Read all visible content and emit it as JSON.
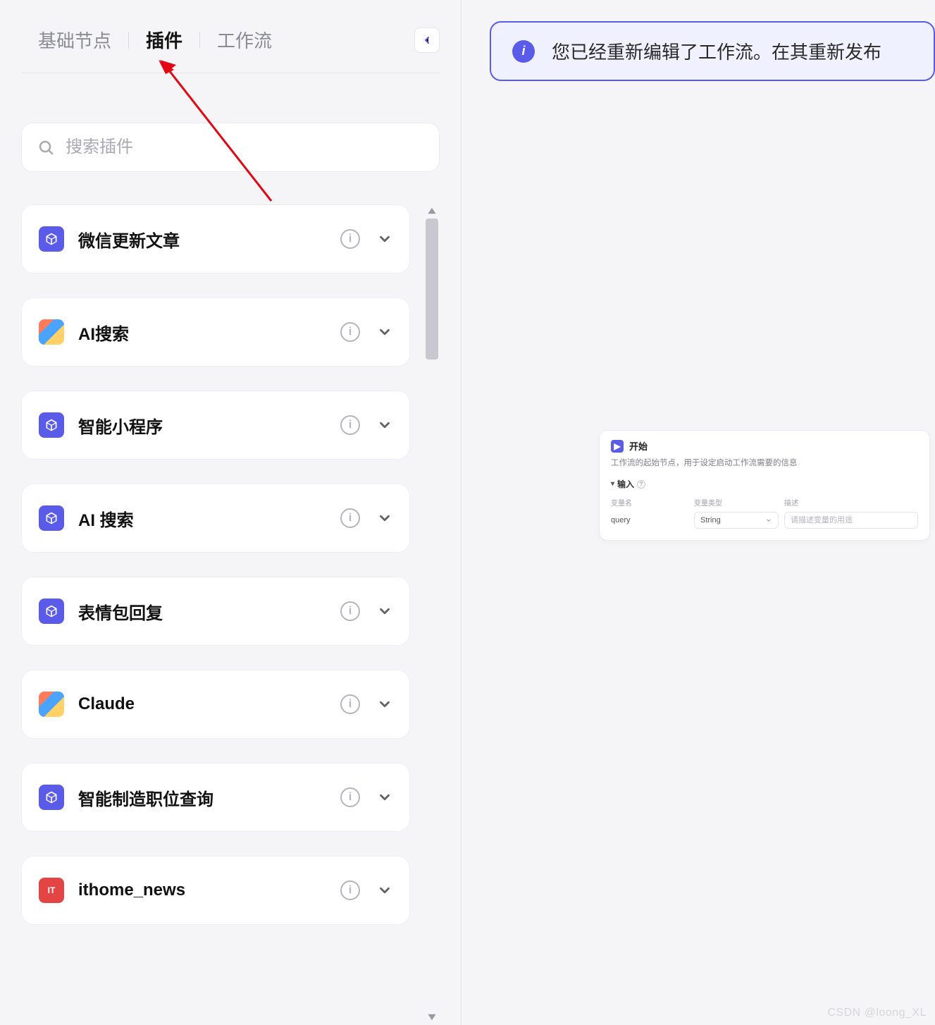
{
  "sidebar": {
    "tabs": [
      {
        "label": "基础节点",
        "active": false
      },
      {
        "label": "插件",
        "active": true
      },
      {
        "label": "工作流",
        "active": false
      }
    ],
    "search_placeholder": "搜索插件",
    "plugins": [
      {
        "name": "微信更新文章",
        "icon": "cube"
      },
      {
        "name": "AI搜索",
        "icon": "img1"
      },
      {
        "name": "智能小程序",
        "icon": "cube"
      },
      {
        "name": "AI 搜索",
        "icon": "cube"
      },
      {
        "name": "表情包回复",
        "icon": "cube"
      },
      {
        "name": "Claude",
        "icon": "img1"
      },
      {
        "name": "智能制造职位查询",
        "icon": "cube"
      },
      {
        "name": "ithome_news",
        "icon": "red",
        "badge": "IT"
      }
    ]
  },
  "notice": {
    "text": "您已经重新编辑了工作流。在其重新发布"
  },
  "node": {
    "title": "开始",
    "description": "工作流的起始节点，用于设定启动工作流需要的信息",
    "section_label": "输入",
    "columns": {
      "name": "变量名",
      "type": "变量类型",
      "desc": "描述"
    },
    "row": {
      "name": "query",
      "type": "String",
      "desc_placeholder": "请描述变量的用途"
    }
  },
  "watermark": "CSDN @loong_XL"
}
